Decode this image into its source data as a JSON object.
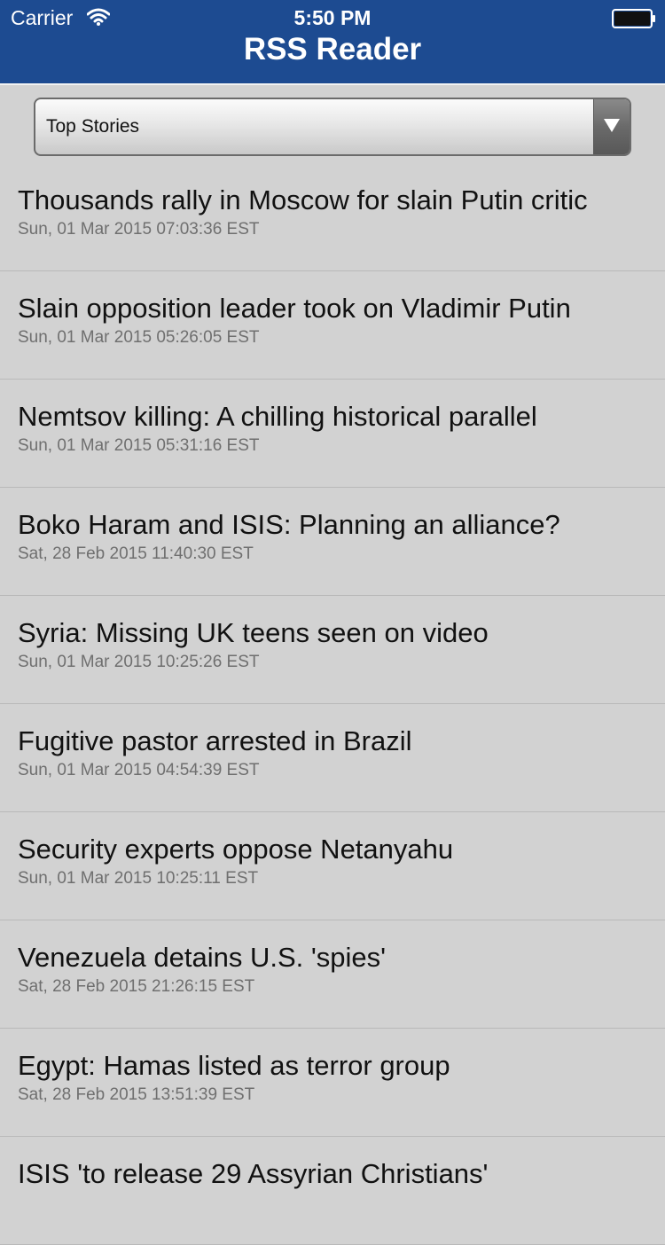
{
  "status_bar": {
    "carrier": "Carrier",
    "time": "5:50 PM",
    "wifi_icon": "wifi-icon",
    "battery_icon": "battery-icon"
  },
  "nav": {
    "title": "RSS Reader",
    "background_color": "#1d4b91"
  },
  "feed_selector": {
    "selected": "Top Stories",
    "arrow_icon": "chevron-down-icon"
  },
  "stories": [
    {
      "title": "Thousands rally in Moscow for slain Putin critic",
      "date": "Sun, 01 Mar 2015 07:03:36 EST"
    },
    {
      "title": "Slain opposition leader took on Vladimir Putin",
      "date": "Sun, 01 Mar 2015 05:26:05 EST"
    },
    {
      "title": "Nemtsov killing: A chilling historical parallel",
      "date": "Sun, 01 Mar 2015 05:31:16 EST"
    },
    {
      "title": "Boko Haram and ISIS: Planning an alliance?",
      "date": "Sat, 28 Feb 2015 11:40:30 EST"
    },
    {
      "title": "Syria: Missing UK teens seen on video",
      "date": "Sun, 01 Mar 2015 10:25:26 EST"
    },
    {
      "title": "Fugitive pastor arrested in Brazil",
      "date": "Sun, 01 Mar 2015 04:54:39 EST"
    },
    {
      "title": "Security experts oppose Netanyahu",
      "date": "Sun, 01 Mar 2015 10:25:11 EST"
    },
    {
      "title": "Venezuela detains U.S. 'spies'",
      "date": "Sat, 28 Feb 2015 21:26:15 EST"
    },
    {
      "title": "Egypt: Hamas listed as terror group",
      "date": "Sat, 28 Feb 2015 13:51:39 EST"
    },
    {
      "title": "ISIS 'to release 29 Assyrian Christians'",
      "date": ""
    }
  ]
}
